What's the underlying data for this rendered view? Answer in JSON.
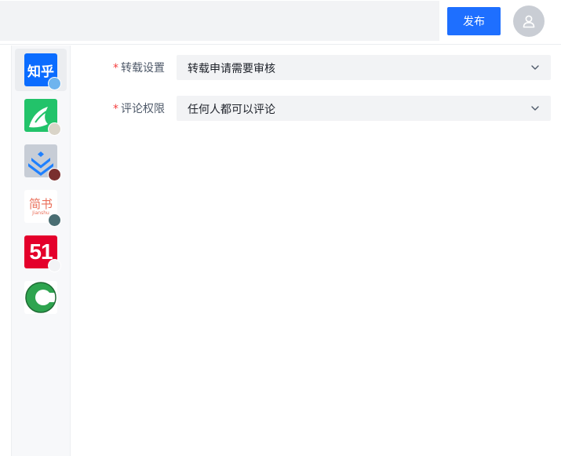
{
  "header": {
    "title_value": "",
    "publish_label": "发布"
  },
  "platforms": [
    {
      "name": "zhihu",
      "logo_text": "知乎",
      "active": true
    },
    {
      "name": "yuque",
      "logo_text": "",
      "active": false
    },
    {
      "name": "juejin",
      "logo_text": "",
      "active": false
    },
    {
      "name": "jianshu",
      "logo_text": "简书",
      "logo_subtext": "Jianshu",
      "active": false
    },
    {
      "name": "51cto",
      "logo_text": "51",
      "active": false
    },
    {
      "name": "csdn",
      "logo_text": "C",
      "active": false
    }
  ],
  "form": {
    "repost": {
      "required_mark": "*",
      "label": "转载设置",
      "value": "转载申请需要审核"
    },
    "comment": {
      "required_mark": "*",
      "label": "评论权限",
      "value": "任何人都可以评论"
    }
  },
  "colors": {
    "primary": "#1e6fff",
    "required": "#f53f3f",
    "input_bg": "#f2f3f5"
  }
}
